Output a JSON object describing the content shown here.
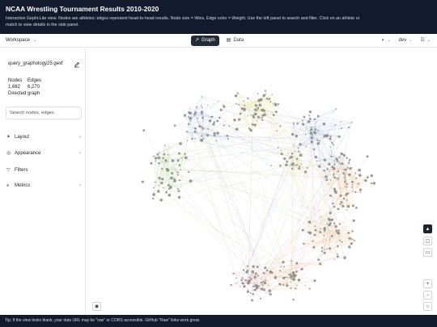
{
  "header": {
    "title": "NCAA Wrestling Tournament Results 2010-2020",
    "description": "Interactive Gephi-Lite view. Nodes are athletes; edges represent head-to-head results. Node size = Wins, Edge color = Weight. Use the left panel to search and filter. Click on an athlete or match to view details in the side panel."
  },
  "toolbar": {
    "workspace_label": "Workspace",
    "tabs": [
      {
        "label": "Graph",
        "icon": "graph-icon",
        "active": true
      },
      {
        "label": "Data",
        "icon": "table-icon",
        "active": false
      }
    ],
    "theme_icon": "contrast-icon",
    "branch_label": "dev",
    "language_icon": "language-icon"
  },
  "sidebar": {
    "filename": "query_graphology25.gexf",
    "stats": {
      "nodes_label": "Nodes",
      "edges_label": "Edges",
      "nodes_value": "1,662",
      "edges_value": "6,270",
      "graph_type": "Directed graph"
    },
    "search_placeholder": "Search nodes, edges",
    "menu": [
      {
        "label": "Layout",
        "icon": "layout-icon",
        "has_chevron": true
      },
      {
        "label": "Appearance",
        "icon": "palette-icon",
        "has_chevron": true
      },
      {
        "label": "Filters",
        "icon": "filter-icon",
        "has_chevron": false
      },
      {
        "label": "Metrics",
        "icon": "metrics-icon",
        "has_chevron": true
      }
    ]
  },
  "graph_controls": [
    "pointer-icon",
    "lasso-icon",
    "comment-icon",
    "zoom-in-icon",
    "zoom-out-icon",
    "center-icon",
    "fullscreen-icon"
  ],
  "footer": {
    "tip": "Tip: If the view looks blank, your data URL may be \"raw\" or CORS accessible. GitHub \"Raw\" links work great."
  },
  "colors": {
    "banner_bg": "#141a2e",
    "active_tab_bg": "#242a36",
    "cluster_pink": "#d9a0b0",
    "cluster_green": "#b9d6a6",
    "cluster_yellow": "#e6e39c",
    "cluster_blue": "#a9bfe2",
    "cluster_orange": "#f0c39c",
    "node_gray": "#8a8a8a"
  }
}
